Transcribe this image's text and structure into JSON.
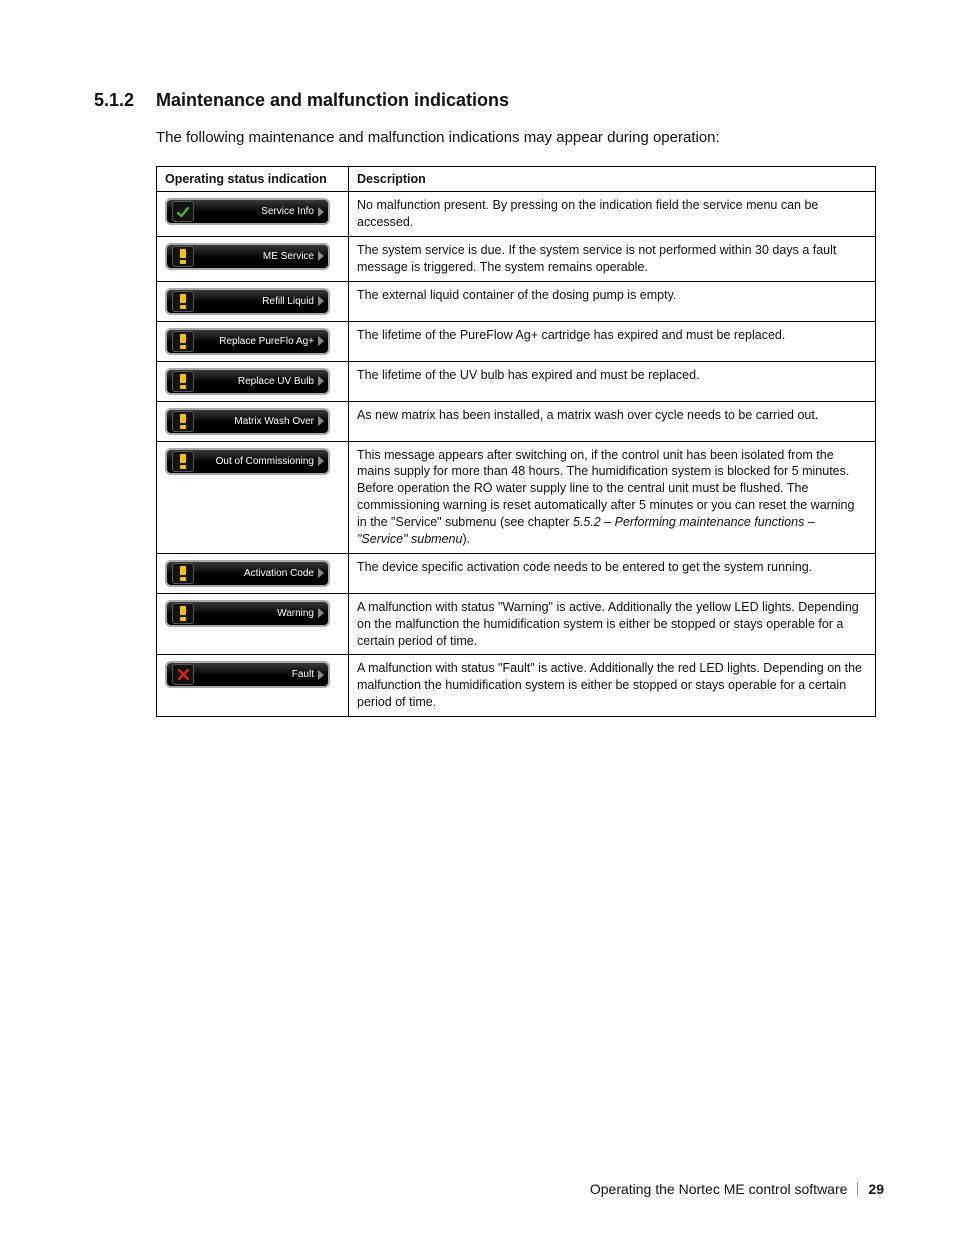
{
  "heading": {
    "number": "5.1.2",
    "title": "Maintenance and malfunction indications"
  },
  "intro": "The following maintenance and malfunction indications may appear during operation:",
  "headers": {
    "col1": "Operating status indication",
    "col2": "Description"
  },
  "rows": [
    {
      "icon": "check",
      "label": "Service Info",
      "desc": "No malfunction present. By pressing on the indication field the service menu can be accessed."
    },
    {
      "icon": "excl",
      "label": "ME Service",
      "desc": "The system service is due. If the system service is not performed within 30 days a fault message is triggered. The system remains operable."
    },
    {
      "icon": "excl",
      "label": "Refill Liquid",
      "desc": "The external liquid container of the dosing pump is empty."
    },
    {
      "icon": "excl",
      "label": "Replace PureFlo Ag+",
      "desc": "The lifetime of the PureFlow Ag+ cartridge has expired and must be replaced."
    },
    {
      "icon": "excl",
      "label": "Replace UV Bulb",
      "desc": "The lifetime of the UV bulb has expired and must be replaced."
    },
    {
      "icon": "excl",
      "label": "Matrix Wash Over",
      "desc": "As new matrix has been installed, a matrix wash over cycle needs to be carried out."
    },
    {
      "icon": "excl",
      "label": "Out of Commissioning",
      "desc_pre": "This message appears after switching on, if the control unit has been isolated from the mains supply for more than 48 hours. The humidification system is blocked for 5 minutes. Before operation the RO water supply line to the central unit must be flushed. The commissioning warning is reset automatically after 5 minutes or you can reset the warning in the \"Service\" submenu (see chapter ",
      "desc_italic": "5.5.2 – Performing maintenance functions –  \"Service\" submenu",
      "desc_post": ")."
    },
    {
      "icon": "excl",
      "label": "Activation Code",
      "desc": "The device specific activation code needs to be entered to get the system running."
    },
    {
      "icon": "excl",
      "label": "Warning",
      "desc": "A malfunction with status \"Warning\" is active. Additionally the yellow LED lights. Depending on the malfunction the humidification system is either be stopped or stays operable for a certain period of time."
    },
    {
      "icon": "cross",
      "label": "Fault",
      "desc": "A malfunction with status \"Fault\" is active. Additionally the red LED lights. Depending on the malfunction the humidification system is either be stopped or stays operable for a certain period of time."
    }
  ],
  "footer": {
    "text": "Operating the Nortec ME control software",
    "page": "29"
  }
}
